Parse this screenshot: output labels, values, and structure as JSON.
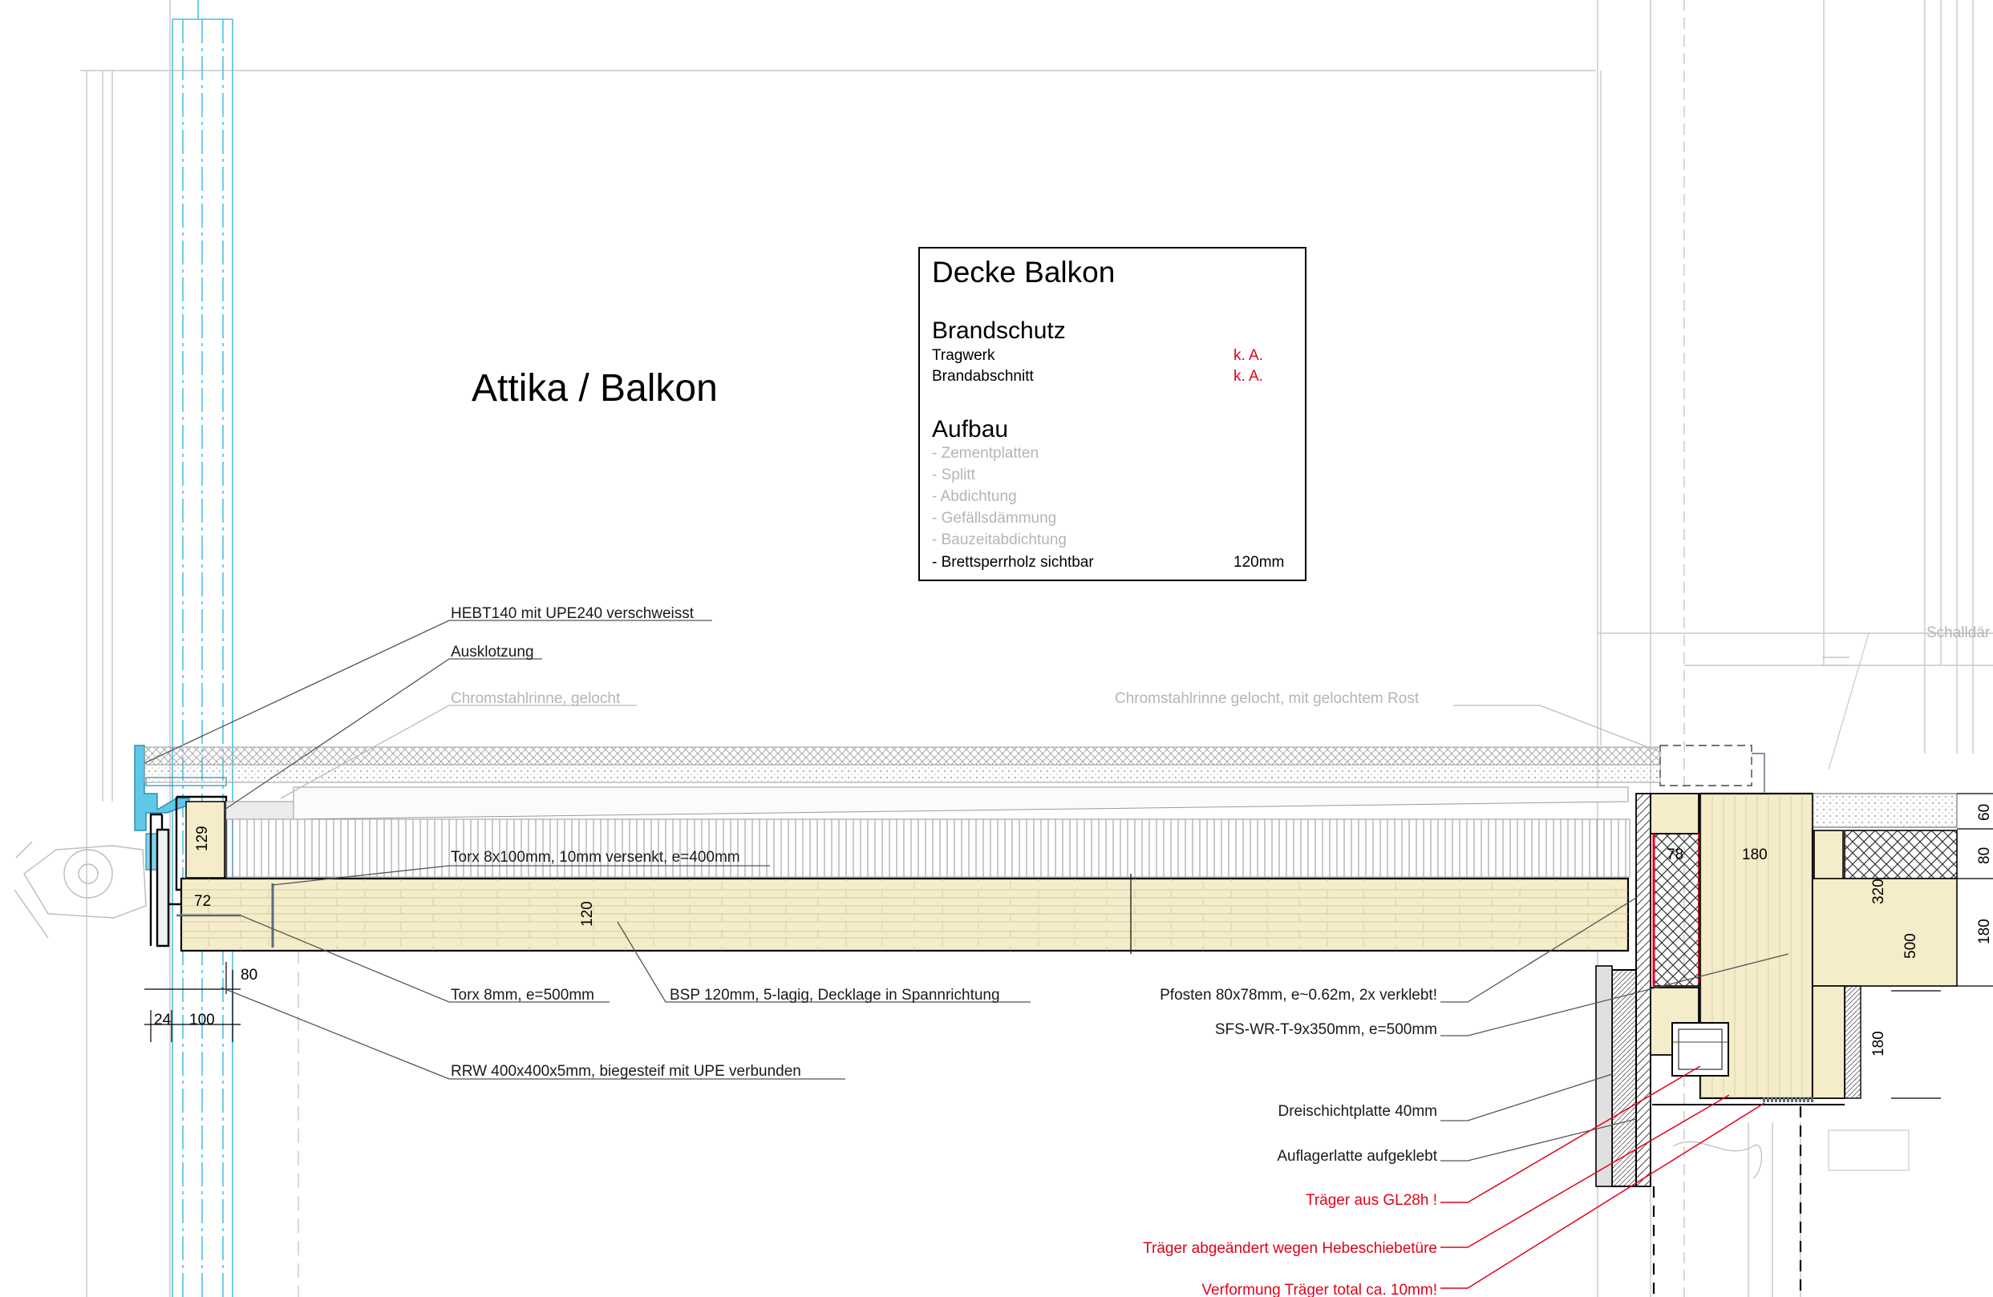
{
  "drawing_title": "Attika / Balkon",
  "info_box": {
    "title": "Decke Balkon",
    "section_fire": "Brandschutz",
    "fire_rows": [
      {
        "label": "Tragwerk",
        "value": "k. A."
      },
      {
        "label": "Brandabschnitt",
        "value": "k. A."
      }
    ],
    "section_build": "Aufbau",
    "build_layers": [
      {
        "label": "- Zementplatten",
        "value": "",
        "faded": true
      },
      {
        "label": "- Splitt",
        "value": "",
        "faded": true
      },
      {
        "label": "- Abdichtung",
        "value": "",
        "faded": true
      },
      {
        "label": "- Gefällsdämmung",
        "value": "",
        "faded": true
      },
      {
        "label": "- Bauzeitabdichtung",
        "value": "",
        "faded": true
      },
      {
        "label": "- Brettsperrholz sichtbar",
        "value": "120mm",
        "faded": false
      }
    ]
  },
  "annotations": {
    "hebt": "HEBT140 mit UPE240 verschweisst",
    "ausklotzung": "Ausklotzung",
    "rinne_left": "Chromstahlrinne, gelocht",
    "rinne_right": "Chromstahlrinne gelocht,  mit gelochtem Rost",
    "schall": "Schalldär",
    "torx_100": "Torx 8x100mm, 10mm versenkt, e=400mm",
    "torx_8": "Torx 8mm, e=500mm",
    "bsp": "BSP 120mm, 5-lagig, Decklage in Spannrichtung",
    "rrw": "RRW 400x400x5mm, biegesteif mit UPE verbunden",
    "pfosten": "Pfosten 80x78mm, e~0.62m, 2x verklebt!",
    "sfs": "SFS-WR-T-9x350mm, e=500mm",
    "dreischicht": "Dreischichtplatte 40mm",
    "auflagerlatte": "Auflagerlatte aufgeklebt",
    "traeger_gl": "Träger aus GL28h !",
    "traeger_hebe": "Träger abgeändert wegen Hebeschiebetüre",
    "verformung": "Verformung Träger total ca. 10mm!"
  },
  "dimensions": {
    "d129": "129",
    "d72": "72",
    "d120": "120",
    "d80_left": "80",
    "d24": "24",
    "d100": "100",
    "d78": "78",
    "d180_top": "180",
    "d60": "60",
    "d80_right": "80",
    "d320": "320",
    "d180_right": "180",
    "d500": "500",
    "d180_low": "180"
  },
  "colors": {
    "timber_fill": "#f5ecc9",
    "steel_cyan": "#5fc8e8",
    "warning_red": "#e3001b",
    "faded_grey": "#b5b5b5",
    "line_black": "#111111"
  }
}
